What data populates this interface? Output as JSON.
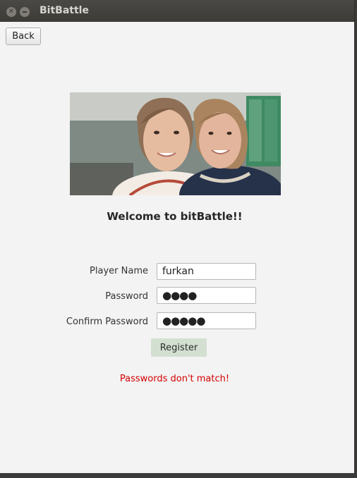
{
  "window": {
    "title": "BitBattle"
  },
  "toolbar": {
    "back_label": "Back"
  },
  "main": {
    "welcome": "Welcome to bitBattle!!",
    "form": {
      "player_name_label": "Player Name",
      "player_name_value": "furkan",
      "password_label": "Password",
      "password_value": "●●●●",
      "confirm_label": "Confirm Password",
      "confirm_value": "●●●●●",
      "register_label": "Register"
    },
    "error": "Passwords don't match!"
  },
  "colors": {
    "error": "#d40000",
    "register_bg": "#d3e0d1",
    "titlebar": "#3d3b37"
  },
  "icons": [
    "close-icon",
    "minimize-icon"
  ]
}
